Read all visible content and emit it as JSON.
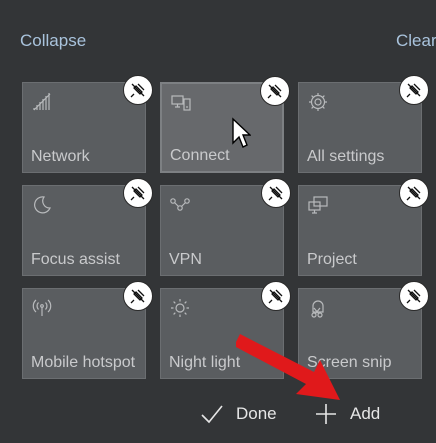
{
  "header": {
    "collapse_label": "Collapse",
    "clear_label": "Clear"
  },
  "tiles": [
    {
      "label": "Network",
      "icon": "network-icon"
    },
    {
      "label": "Connect",
      "icon": "connect-icon"
    },
    {
      "label": "All settings",
      "icon": "settings-gear-icon"
    },
    {
      "label": "Focus assist",
      "icon": "moon-icon"
    },
    {
      "label": "VPN",
      "icon": "vpn-icon"
    },
    {
      "label": "Project",
      "icon": "project-icon"
    },
    {
      "label": "Mobile hotspot",
      "icon": "hotspot-icon"
    },
    {
      "label": "Night light",
      "icon": "sun-icon"
    },
    {
      "label": "Screen snip",
      "icon": "screen-snip-icon"
    }
  ],
  "footer": {
    "done_label": "Done",
    "add_label": "Add"
  },
  "colors": {
    "background": "#333537",
    "tile": "#5a5d60",
    "link": "#a9c3dc",
    "annotation_arrow": "#e0191b"
  }
}
